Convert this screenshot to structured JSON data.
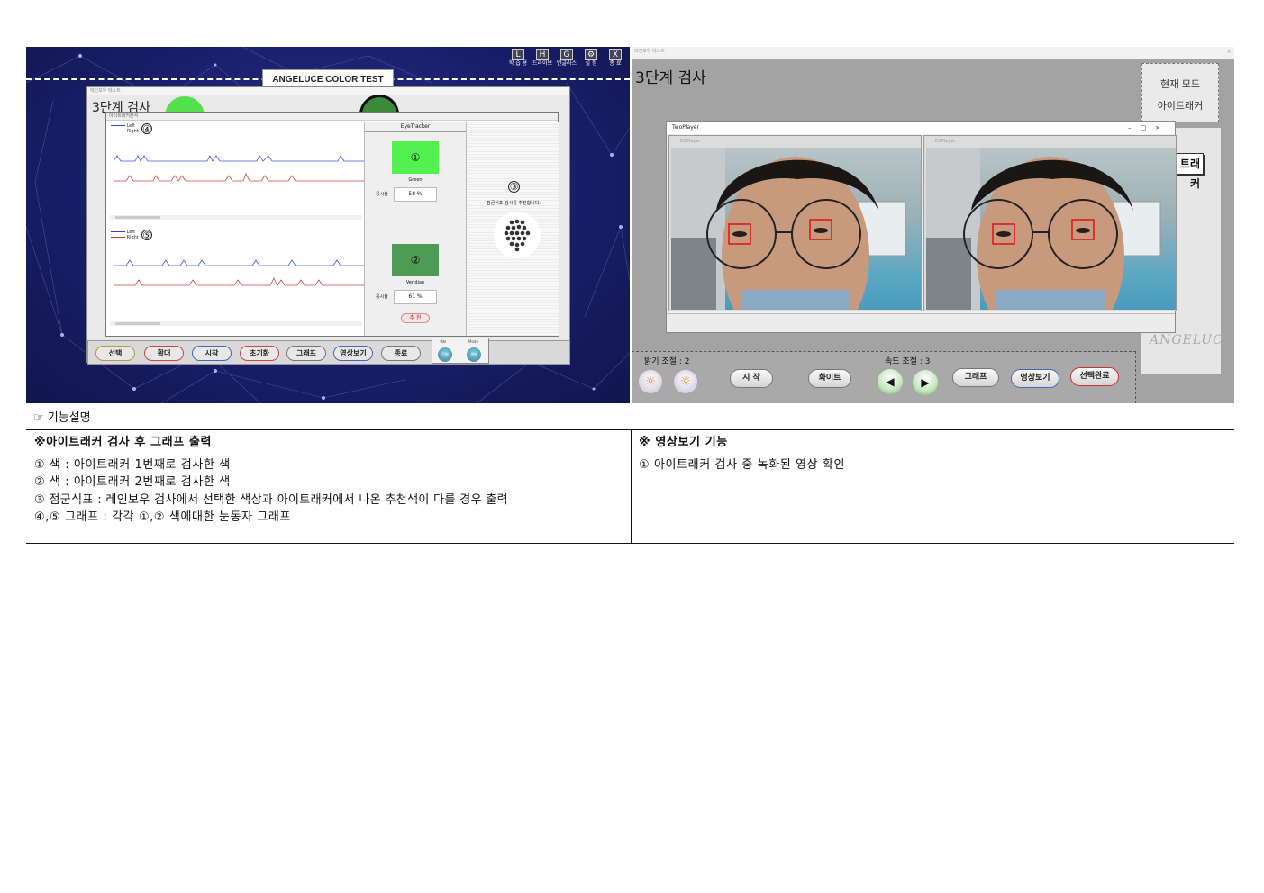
{
  "left_screen": {
    "app_title": "ANGELUCE COLOR TEST",
    "toolbar": [
      {
        "glyph": "L",
        "label": "학 습 용"
      },
      {
        "glyph": "H",
        "label": "드라이브"
      },
      {
        "glyph": "G",
        "label": "변글라스"
      },
      {
        "glyph": "⚙",
        "label": "설 정"
      },
      {
        "glyph": "X",
        "label": "종 료"
      }
    ],
    "inner_window_title": "레인보우 테스트",
    "step_title": "3단계 검사",
    "graph_window_title": "아이트래커분석",
    "legend": {
      "left": "Left",
      "right": "Right"
    },
    "plot1_marker": "④",
    "plot2_marker": "⑤",
    "eyetracker": {
      "title": "EyeTracker",
      "swatch1": {
        "marker": "①",
        "name": "Green",
        "ratio_label": "응시율",
        "ratio_value": "58 %",
        "color": "#52f14f"
      },
      "swatch2": {
        "marker": "②",
        "name": "Veridian",
        "ratio_label": "응시율",
        "ratio_value": "61 %",
        "color": "#4e9b55"
      },
      "recommend_button": "추 천"
    },
    "dot_panel": {
      "marker": "③",
      "text": "점군식표 검사를 추천합니다."
    },
    "bottom_buttons": [
      "선택",
      "확대",
      "시작",
      "초기화",
      "그래프",
      "영상보기",
      "종료"
    ],
    "side_controls": {
      "label1": "색표",
      "label2": "Mode",
      "btn1": "단체",
      "btn2": "개체"
    }
  },
  "right_screen": {
    "window_title": "레인보우 테스트",
    "close": "×",
    "step_title": "3단계 검사",
    "mode_box": {
      "line1": "현재 모드",
      "line2": "아이트래커"
    },
    "tracker_tab": "트래커",
    "player_title": "TwoPlayer",
    "player_controls": "–□×",
    "ds_title_1": "DSPlayer",
    "ds_title_2": "DSPlayer",
    "logo": "ANGELUC",
    "brightness_label": "밝기 조절 : 2",
    "speed_label": "속도 조절 : 3",
    "buttons": {
      "start": "시 작",
      "white": "화이트",
      "graph": "그래프",
      "video": "영상보기",
      "done": "선택완료"
    }
  },
  "description": {
    "heading": "☞ 기능설명",
    "left": {
      "title": "※아이트래커 검사 후 그래프 출력",
      "lines": [
        "① 색 : 아이트래커 1번째로 검사한 색",
        "② 색 : 아이트래커 2번째로 검사한 색",
        "③ 점군식표 : 레인보우 검사에서 선택한 색상과 아이트래커에서 나온 추천색이 다를 경우 출력",
        "④,⑤ 그래프 : 각각 ①,② 색에대한 눈동자 그래프"
      ]
    },
    "right": {
      "title": "※ 영상보기 기능",
      "lines": [
        "① 아이트래커 검사 중 녹화된 영상 확인"
      ]
    }
  }
}
